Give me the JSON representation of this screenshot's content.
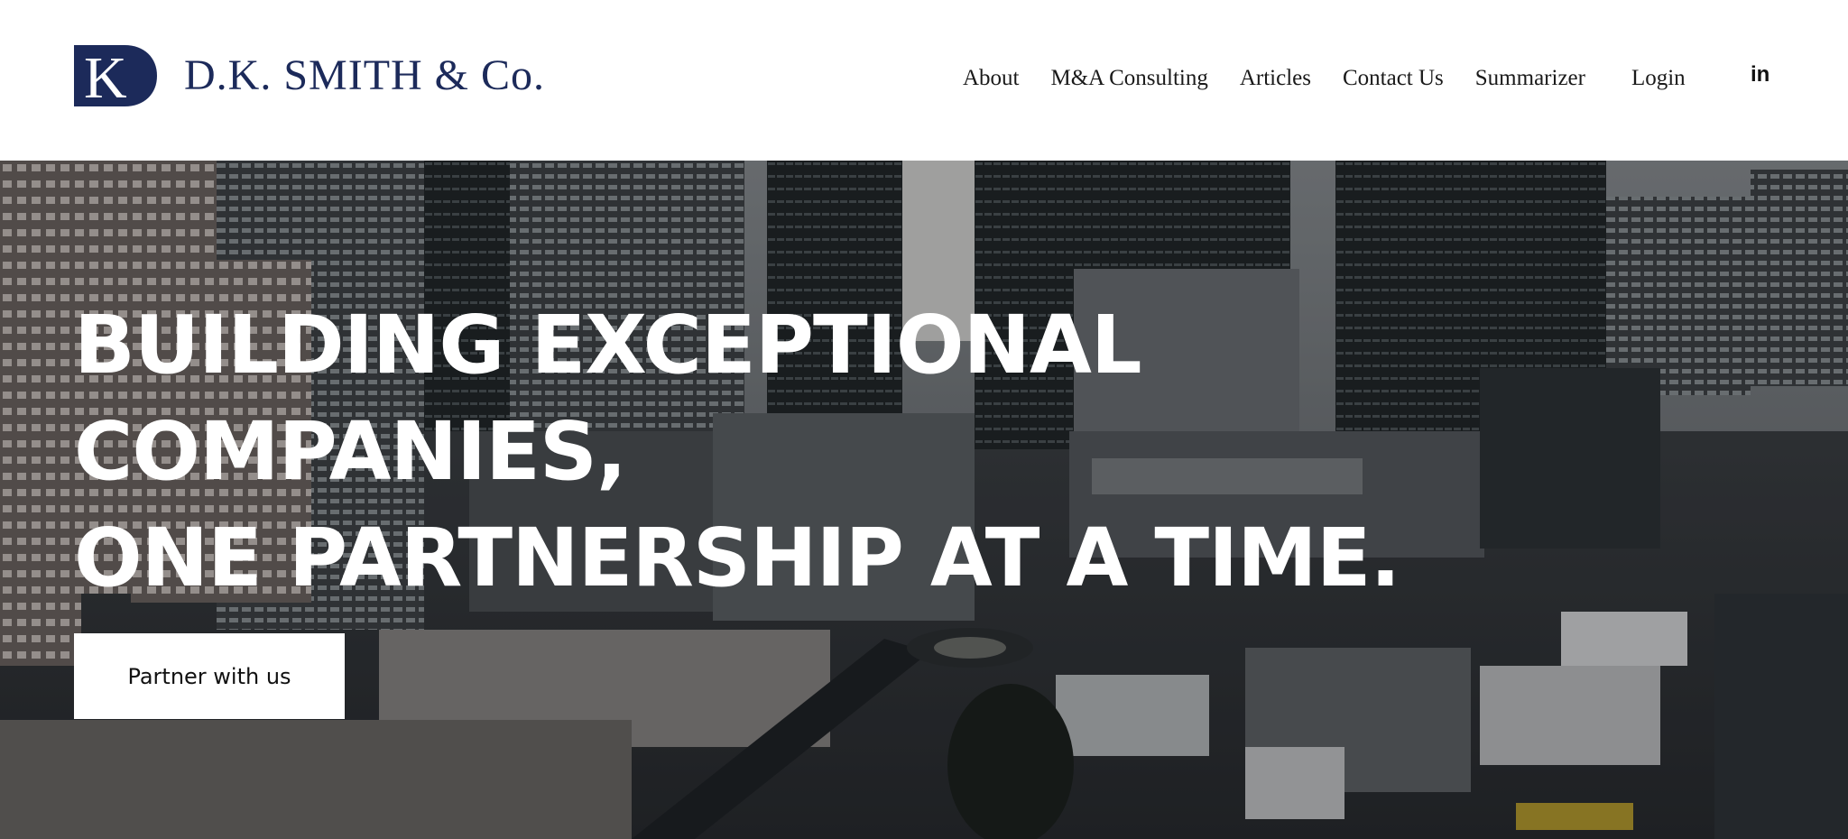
{
  "brand": {
    "logo_letter": "K",
    "name": "D.K. SMITH & Co.",
    "color": "#1c2a5a"
  },
  "nav": {
    "items": [
      {
        "label": "About"
      },
      {
        "label": "M&A Consulting"
      },
      {
        "label": "Articles"
      },
      {
        "label": "Contact Us"
      },
      {
        "label": "Summarizer"
      }
    ],
    "login": "Login",
    "social_icon": "linkedin-icon",
    "social_label": "in"
  },
  "hero": {
    "headline": [
      "BUILDING EXCEPTIONAL",
      "COMPANIES,",
      "ONE PARTNERSHIP AT A TIME."
    ],
    "cta_label": "Partner with us",
    "background": "aerial-city-photo"
  }
}
